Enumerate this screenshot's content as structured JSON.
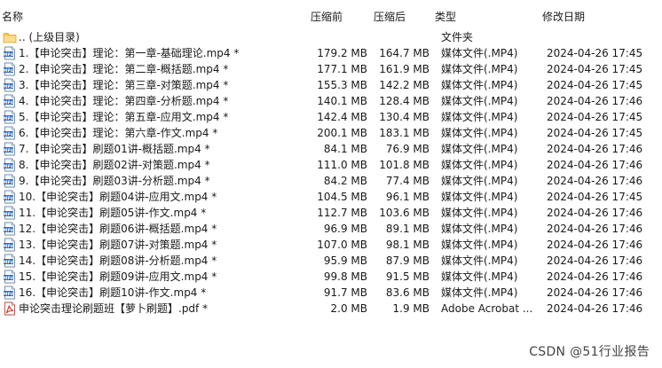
{
  "header": {
    "name": "名称",
    "packed": "压缩前",
    "unpacked": "压缩后",
    "type": "类型",
    "modified": "修改日期"
  },
  "rows": [
    {
      "icon": "folder-up-icon",
      "name": ".. (上级目录)",
      "packed": "",
      "unpacked": "",
      "type": "文件夹",
      "modified": ""
    },
    {
      "icon": "mp4-file-icon",
      "name": "1.【申论突击】理论：第一章-基础理论.mp4 *",
      "packed": "179.2 MB",
      "unpacked": "164.7 MB",
      "type": "媒体文件(.MP4)",
      "modified": "2024-04-26 17:45"
    },
    {
      "icon": "mp4-file-icon",
      "name": "2.【申论突击】理论：第二章-概括题.mp4 *",
      "packed": "177.1 MB",
      "unpacked": "161.9 MB",
      "type": "媒体文件(.MP4)",
      "modified": "2024-04-26 17:45"
    },
    {
      "icon": "mp4-file-icon",
      "name": "3.【申论突击】理论：第三章-对策题.mp4 *",
      "packed": "155.3 MB",
      "unpacked": "142.2 MB",
      "type": "媒体文件(.MP4)",
      "modified": "2024-04-26 17:45"
    },
    {
      "icon": "mp4-file-icon",
      "name": "4.【申论突击】理论：第四章-分析题.mp4 *",
      "packed": "140.1 MB",
      "unpacked": "128.4 MB",
      "type": "媒体文件(.MP4)",
      "modified": "2024-04-26 17:46"
    },
    {
      "icon": "mp4-file-icon",
      "name": "5.【申论突击】理论：第五章-应用文.mp4 *",
      "packed": "142.4 MB",
      "unpacked": "130.4 MB",
      "type": "媒体文件(.MP4)",
      "modified": "2024-04-26 17:45"
    },
    {
      "icon": "mp4-file-icon",
      "name": "6.【申论突击】理论：第六章-作文.mp4 *",
      "packed": "200.1 MB",
      "unpacked": "183.1 MB",
      "type": "媒体文件(.MP4)",
      "modified": "2024-04-26 17:45"
    },
    {
      "icon": "mp4-file-icon",
      "name": "7.【申论突击】刷题01讲-概括题.mp4 *",
      "packed": "84.1 MB",
      "unpacked": "76.9 MB",
      "type": "媒体文件(.MP4)",
      "modified": "2024-04-26 17:46"
    },
    {
      "icon": "mp4-file-icon",
      "name": "8.【申论突击】刷题02讲-对策题.mp4 *",
      "packed": "111.0 MB",
      "unpacked": "101.8 MB",
      "type": "媒体文件(.MP4)",
      "modified": "2024-04-26 17:46"
    },
    {
      "icon": "mp4-file-icon",
      "name": "9.【申论突击】刷题03讲-分析题.mp4 *",
      "packed": "84.2 MB",
      "unpacked": "77.4 MB",
      "type": "媒体文件(.MP4)",
      "modified": "2024-04-26 17:46"
    },
    {
      "icon": "mp4-file-icon",
      "name": "10.【申论突击】刷题04讲-应用文.mp4 *",
      "packed": "104.5 MB",
      "unpacked": "96.1 MB",
      "type": "媒体文件(.MP4)",
      "modified": "2024-04-26 17:45"
    },
    {
      "icon": "mp4-file-icon",
      "name": "11.【申论突击】刷题05讲-作文.mp4 *",
      "packed": "112.7 MB",
      "unpacked": "103.6 MB",
      "type": "媒体文件(.MP4)",
      "modified": "2024-04-26 17:46"
    },
    {
      "icon": "mp4-file-icon",
      "name": "12.【申论突击】刷题06讲-概括题.mp4 *",
      "packed": "96.9 MB",
      "unpacked": "89.1 MB",
      "type": "媒体文件(.MP4)",
      "modified": "2024-04-26 17:46"
    },
    {
      "icon": "mp4-file-icon",
      "name": "13.【申论突击】刷题07讲-对策题.mp4 *",
      "packed": "107.0 MB",
      "unpacked": "98.1 MB",
      "type": "媒体文件(.MP4)",
      "modified": "2024-04-26 17:46"
    },
    {
      "icon": "mp4-file-icon",
      "name": "14.【申论突击】刷题08讲-分析题.mp4 *",
      "packed": "95.9 MB",
      "unpacked": "87.9 MB",
      "type": "媒体文件(.MP4)",
      "modified": "2024-04-26 17:46"
    },
    {
      "icon": "mp4-file-icon",
      "name": "15.【申论突击】刷题09讲-应用文.mp4 *",
      "packed": "99.8 MB",
      "unpacked": "91.5 MB",
      "type": "媒体文件(.MP4)",
      "modified": "2024-04-26 17:46"
    },
    {
      "icon": "mp4-file-icon",
      "name": "16.【申论突击】刷题10讲-作文.mp4 *",
      "packed": "91.7 MB",
      "unpacked": "83.6 MB",
      "type": "媒体文件(.MP4)",
      "modified": "2024-04-26 17:46"
    },
    {
      "icon": "pdf-file-icon",
      "name": "申论突击理论刷题班【萝卜刷题】.pdf *",
      "packed": "2.0 MB",
      "unpacked": "1.9 MB",
      "type": "Adobe Acrobat ...",
      "modified": "2024-04-26 17:46"
    }
  ],
  "watermark": "CSDN @51行业报告",
  "colors": {
    "folder": "#f3c75a",
    "folder_dark": "#d9a72b",
    "mp4_blue": "#2f6fbf",
    "pdf_red": "#d52b1e"
  }
}
